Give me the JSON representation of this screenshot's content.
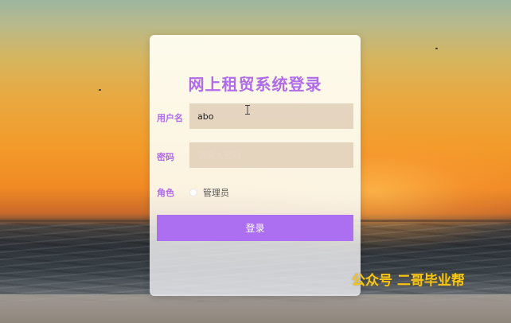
{
  "login_form": {
    "title": "网上租贸系统登录",
    "username_label": "用户名",
    "username_value": "abo",
    "password_label": "密码",
    "password_placeholder": "请输入密码",
    "role_label": "角色",
    "role_option": "管理员",
    "submit_label": "登录"
  },
  "watermark": {
    "text": "公众号 二哥毕业帮"
  },
  "colors": {
    "accent": "#ad6ff2",
    "title": "#b06ce8",
    "watermark": "#f5c518"
  }
}
